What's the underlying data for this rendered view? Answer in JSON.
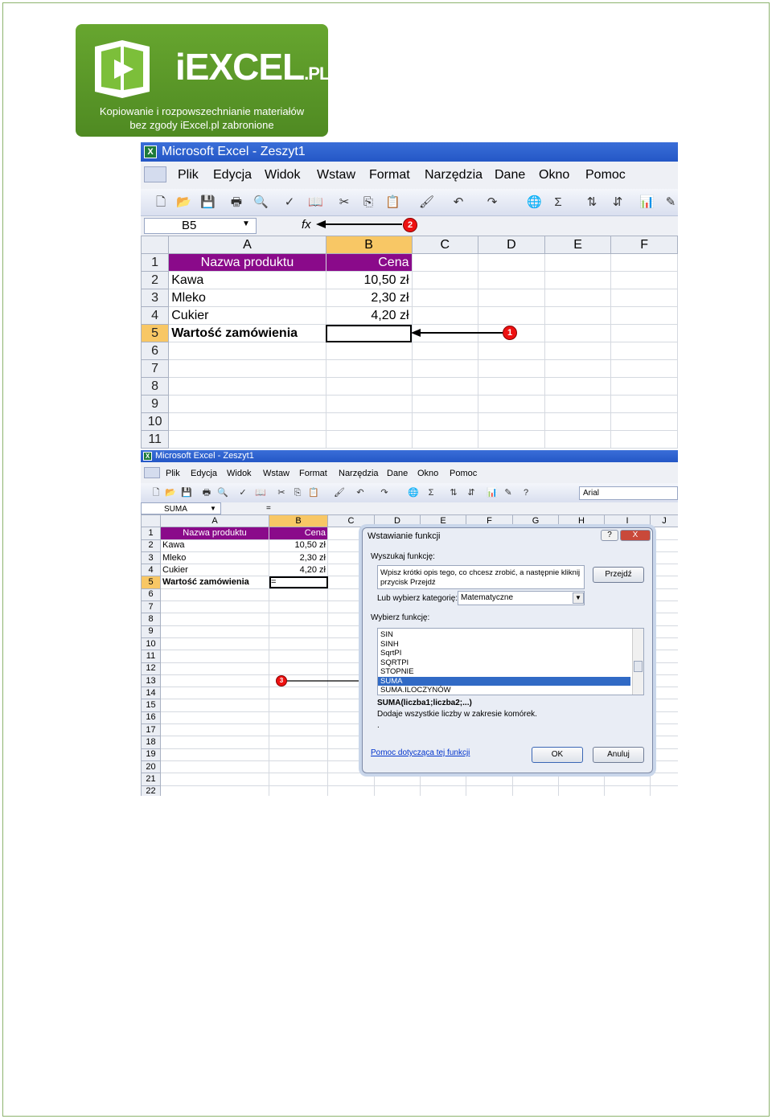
{
  "logo": {
    "brand": "iEXCEL",
    "brand_suffix": ".PL",
    "tagline1": "Kopiowanie i rozpowszechnianie materiałów",
    "tagline2": "bez zgody iExcel.pl zabronione"
  },
  "window_title": "Microsoft Excel - Zeszyt1",
  "menu": [
    "Plik",
    "Edycja",
    "Widok",
    "Wstaw",
    "Format",
    "Narzędzia",
    "Dane",
    "Okno",
    "Pomoc"
  ],
  "shot1": {
    "name_box": "B5",
    "fx": "fx",
    "columns": [
      "A",
      "B",
      "C",
      "D",
      "E",
      "F"
    ],
    "rows": [
      {
        "n": "1",
        "a": "Nazwa produktu",
        "b": "Cena"
      },
      {
        "n": "2",
        "a": "Kawa",
        "b": "10,50 zł"
      },
      {
        "n": "3",
        "a": "Mleko",
        "b": "2,30 zł"
      },
      {
        "n": "4",
        "a": "Cukier",
        "b": "4,20 zł"
      },
      {
        "n": "5",
        "a": "Wartość zamówienia",
        "b": ""
      },
      {
        "n": "6",
        "a": "",
        "b": ""
      },
      {
        "n": "7",
        "a": "",
        "b": ""
      },
      {
        "n": "8",
        "a": "",
        "b": ""
      },
      {
        "n": "9",
        "a": "",
        "b": ""
      },
      {
        "n": "10",
        "a": "",
        "b": ""
      },
      {
        "n": "11",
        "a": "",
        "b": ""
      }
    ],
    "marker1": "1",
    "marker2": "2"
  },
  "shot2": {
    "title": "Microsoft Excel - Zeszyt1",
    "name_box": "SUMA",
    "formula": "=",
    "font": "Arial",
    "columns": [
      "A",
      "B",
      "C",
      "D",
      "E",
      "F",
      "G",
      "H",
      "I",
      "J"
    ],
    "rows": [
      {
        "n": "1",
        "a": "Nazwa produktu",
        "b": "Cena"
      },
      {
        "n": "2",
        "a": "Kawa",
        "b": "10,50 zł"
      },
      {
        "n": "3",
        "a": "Mleko",
        "b": "2,30 zł"
      },
      {
        "n": "4",
        "a": "Cukier",
        "b": "4,20 zł"
      },
      {
        "n": "5",
        "a": "Wartość zamówienia",
        "b": "="
      },
      {
        "n": "6"
      },
      {
        "n": "7"
      },
      {
        "n": "8"
      },
      {
        "n": "9"
      },
      {
        "n": "10"
      },
      {
        "n": "11"
      },
      {
        "n": "12"
      },
      {
        "n": "13"
      },
      {
        "n": "14"
      },
      {
        "n": "15"
      },
      {
        "n": "16"
      },
      {
        "n": "17"
      },
      {
        "n": "18"
      },
      {
        "n": "19"
      },
      {
        "n": "20"
      },
      {
        "n": "21"
      },
      {
        "n": "22"
      }
    ],
    "marker3": "3"
  },
  "dialog": {
    "title": "Wstawianie funkcji",
    "help_btn": "?",
    "close_btn": "X",
    "search_label": "Wyszukaj funkcję:",
    "search_text": "Wpisz krótki opis tego, co chcesz zrobić, a następnie kliknij przycisk Przejdź",
    "go_btn": "Przejdź",
    "category_label": "Lub wybierz kategorię:",
    "category_value": "Matematyczne",
    "select_label": "Wybierz funkcję:",
    "functions": [
      "SIN",
      "SINH",
      "SqrtPI",
      "SQRTPI",
      "STOPNIE",
      "SUMA",
      "SUMA.ILOCZYNÓW"
    ],
    "selected": "SUMA",
    "signature": "SUMA(liczba1;liczba2;...)",
    "description": "Dodaje wszystkie liczby w zakresie komórek.",
    "dot": ".",
    "help_link": "Pomoc dotycząca tej funkcji",
    "ok": "OK",
    "cancel": "Anuluj"
  }
}
